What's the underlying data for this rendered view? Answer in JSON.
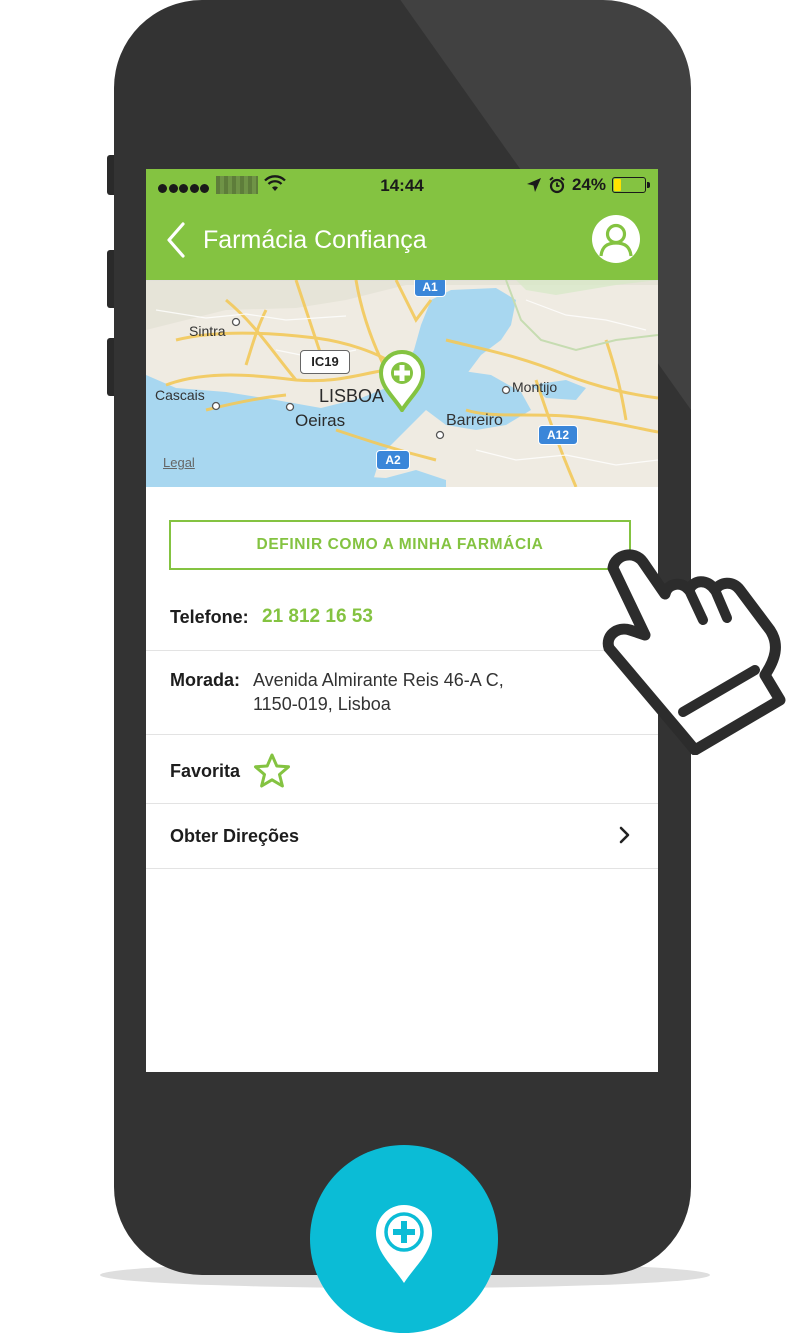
{
  "status_bar": {
    "time": "14:44",
    "battery": "24%",
    "battery_level": 0.24
  },
  "nav": {
    "title": "Farmácia Confiança"
  },
  "map": {
    "labels": {
      "sintra": "Sintra",
      "cascais": "Cascais",
      "lisboa": "LISBOA",
      "oeiras": "Oeiras",
      "montijo": "Montijo",
      "barreiro": "Barreiro"
    },
    "road_labels": {
      "a1": "A1",
      "ic19": "IC19",
      "a2": "A2",
      "a12": "A12"
    },
    "legal_link": "Legal"
  },
  "actions": {
    "set_pharmacy_label": "DEFINIR COMO A MINHA FARMÁCIA"
  },
  "details": {
    "phone_label": "Telefone:",
    "phone_value": "21 812 16 53",
    "address_label": "Morada:",
    "address_line1": "Avenida Almirante Reis 46-A C,",
    "address_line2": "1150-019, Lisboa",
    "favorite_label": "Favorita",
    "directions_label": "Obter Direções"
  },
  "colors": {
    "brand_green": "#84c341",
    "phone_body": "#333333",
    "accent_cyan": "#0bbcd6",
    "water": "#a8d7f0"
  },
  "icons": {
    "back": "chevron-left-icon",
    "profile": "user-icon",
    "favorite": "star-outline-icon",
    "directions": "chevron-right-icon",
    "map_pin": "pharmacy-pin-icon",
    "hand": "pointing-hand-icon"
  }
}
